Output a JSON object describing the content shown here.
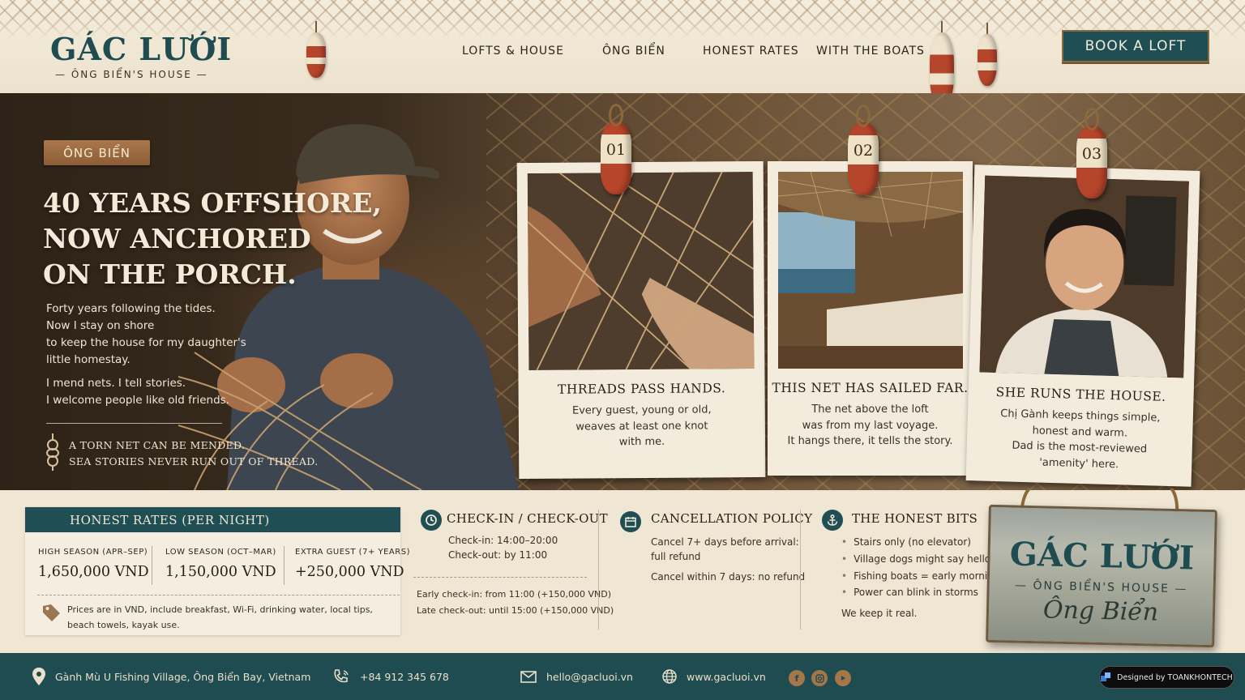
{
  "brand": {
    "title": "GÁC LƯỚI",
    "subtitle": "— ÔNG BIỂN'S HOUSE —"
  },
  "nav": {
    "items": [
      "LOFTS  &  HOUSE",
      "ÔNG  BIỂN",
      "HONEST RATES",
      "WITH THE BOATS"
    ],
    "cta": "BOOK A LOFT"
  },
  "hero": {
    "tag": "ÔNG BIỂN",
    "title_lines": [
      "40 YEARS OFFSHORE,",
      "NOW ANCHORED",
      "ON THE PORCH."
    ],
    "intro_lines": [
      "Forty years following the tides.",
      "Now I stay on shore",
      "to keep the house for my daughter's",
      "little homestay."
    ],
    "intro2_lines": [
      "I mend nets. I tell stories.",
      "I welcome people like old friends."
    ],
    "quote_lines": [
      "A TORN NET CAN BE MENDED.",
      "SEA STORIES NEVER RUN OUT OF THREAD."
    ]
  },
  "cards": [
    {
      "num": "01",
      "title": "THREADS PASS HANDS.",
      "body": [
        "Every guest, young or old,",
        "weaves at least one knot",
        "with me."
      ]
    },
    {
      "num": "02",
      "title": "THIS NET HAS SAILED FAR.",
      "body": [
        "The net above the loft",
        "was from my last voyage.",
        "It hangs there, it tells the story."
      ]
    },
    {
      "num": "03",
      "title": "SHE RUNS THE HOUSE.",
      "body": [
        "Chị Gành keeps things simple,",
        "honest and warm.",
        "Dad is the most-reviewed",
        "'amenity' here."
      ]
    }
  ],
  "rates": {
    "header": "HONEST RATES (PER NIGHT)",
    "columns": [
      {
        "label": "HIGH SEASON (APR–SEP)",
        "value": "1,650,000 VND"
      },
      {
        "label": "LOW SEASON (OCT–MAR)",
        "value": "1,150,000 VND"
      },
      {
        "label": "EXTRA GUEST (7+ YEARS)",
        "value": "+250,000 VND"
      }
    ],
    "note_lines": [
      "Prices are in VND, include breakfast, Wi-Fi, drinking water, local tips,",
      "beach towels, kayak use."
    ]
  },
  "checkin": {
    "title": "CHECK-IN / CHECK-OUT",
    "checkin": "Check-in: 14:00–20:00",
    "checkout": "Check-out: by 11:00",
    "early": "Early check-in: from 11:00 (+150,000 VND)",
    "late": "Late check-out: until 15:00 (+150,000 VND)"
  },
  "cancellation": {
    "title": "CANCELLATION POLICY",
    "line1a": "Cancel 7+ days before arrival:",
    "line1b": "full refund",
    "line2": "Cancel within 7 days: no refund"
  },
  "honest_bits": {
    "title": "THE HONEST BITS",
    "items": [
      "Stairs only (no elevator)",
      "Village dogs might say hello",
      "Fishing boats = early mornings",
      "Power can blink in storms"
    ],
    "closing": "We keep it real."
  },
  "sign": {
    "title": "GÁC LƯỚI",
    "subtitle": "— ÔNG BIỂN'S HOUSE —",
    "script": "Ông Biển"
  },
  "footer": {
    "address": "Gành Mù U Fishing Village, Ông Biển Bay, Vietnam",
    "phone": "+84 912 345 678",
    "email": "hello@gacluoi.vn",
    "website": "www.gacluoi.vn",
    "credit": "Designed by TOANKHONTECH"
  },
  "colors": {
    "teal": "#1f4f55",
    "rust": "#b5452b",
    "paper": "#f3ecdc",
    "wood": "#a9774a"
  }
}
